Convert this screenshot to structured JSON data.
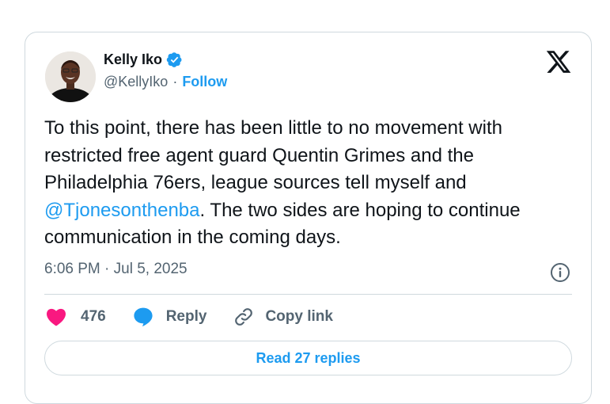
{
  "author": {
    "name": "Kelly Iko",
    "handle": "@KellyIko",
    "separator": "·",
    "follow_label": "Follow",
    "verified": true
  },
  "tweet": {
    "text_before": "To this point, there has been little to no movement with restricted free agent guard Quentin Grimes and the Philadelphia 76ers, league sources tell myself and ",
    "mention": "@Tjonesonthenba",
    "text_after": ". The two sides are hoping to continue communication in the coming days.",
    "timestamp": "6:06 PM · Jul 5, 2025"
  },
  "actions": {
    "likes": "476",
    "reply_label": "Reply",
    "copy_label": "Copy link"
  },
  "read_replies_label": "Read 27 replies",
  "colors": {
    "accent": "#1d9bf0",
    "heart": "#f91880",
    "text": "#0f1419",
    "muted": "#536471",
    "border": "#cfd9de"
  },
  "icons": [
    "verified-badge-icon",
    "x-logo-icon",
    "info-icon",
    "heart-icon",
    "reply-bubble-icon",
    "link-icon"
  ]
}
